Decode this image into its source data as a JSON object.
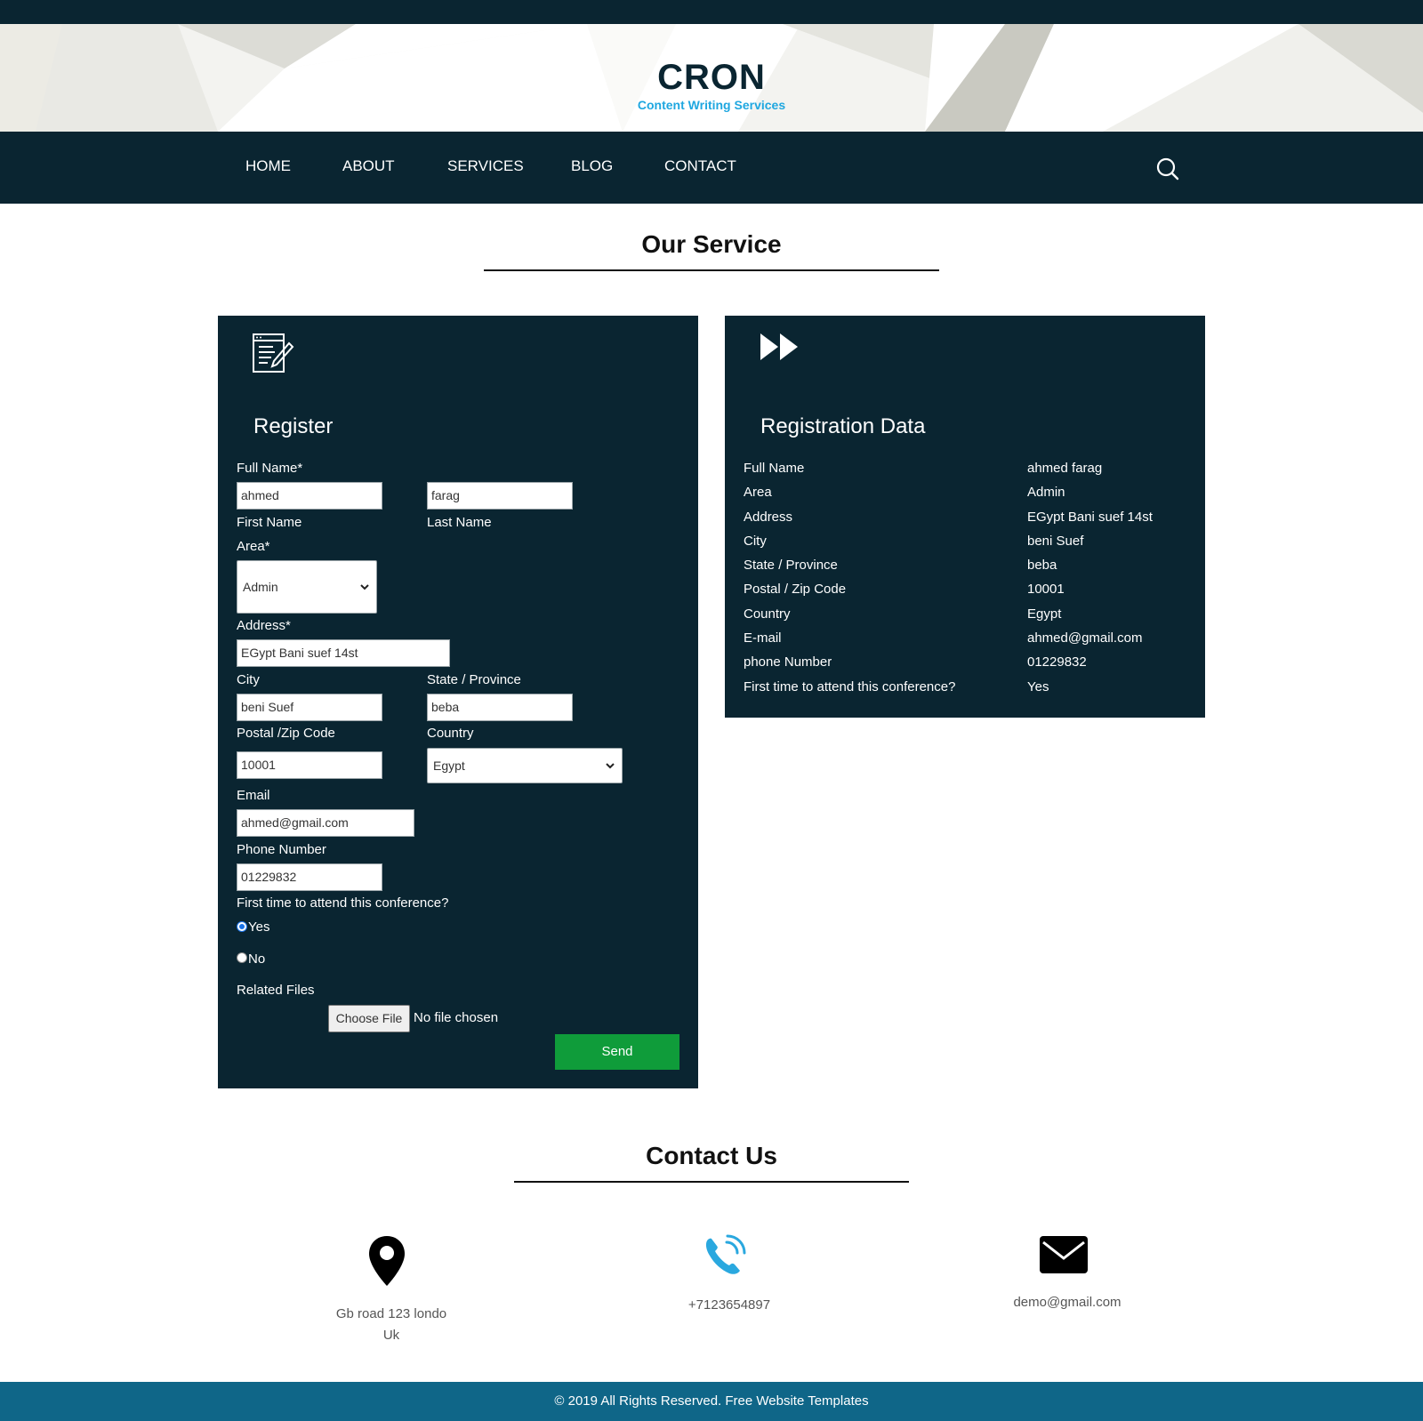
{
  "brand": {
    "name": "CRON",
    "tagline": "Content Writing Services"
  },
  "nav": {
    "items": [
      "HOME",
      "ABOUT",
      "SERVICES",
      "BLOG",
      "CONTACT"
    ],
    "search_icon": "search-icon"
  },
  "service_section": {
    "title": "Our Service"
  },
  "register": {
    "icon": "document-edit-icon",
    "title": "Register",
    "full_name_label": "Full Name*",
    "first_name_value": "ahmed",
    "last_name_value": "farag",
    "first_name_label": "First Name",
    "last_name_label": "Last Name",
    "area_label": "Area*",
    "area_value": "Admin",
    "address_label": "Address*",
    "address_value": "EGypt Bani suef 14st",
    "city_label": "City",
    "city_value": "beni Suef",
    "state_label": "State / Province",
    "state_value": "beba",
    "postal_label": "Postal /Zip Code",
    "postal_value": "10001",
    "country_label": "Country",
    "country_value": "Egypt",
    "email_label": "Email",
    "email_value": "ahmed@gmail.com",
    "phone_label": "Phone Number",
    "phone_value": "01229832",
    "first_time_label": "First time to attend this conference?",
    "yes_label": "Yes",
    "no_label": "No",
    "yes_checked": true,
    "files_label": "Related Files",
    "choose_file_label": "Choose File",
    "no_file_text": "No file chosen",
    "send_label": "Send"
  },
  "registration_data": {
    "icon": "fast-forward-icon",
    "title": "Registration Data",
    "rows": [
      {
        "label": "Full Name",
        "value": "ahmed farag"
      },
      {
        "label": "Area",
        "value": "Admin"
      },
      {
        "label": "Address",
        "value": "EGypt Bani suef 14st"
      },
      {
        "label": "City",
        "value": "beni Suef"
      },
      {
        "label": "State / Province",
        "value": "beba"
      },
      {
        "label": "Postal / Zip Code",
        "value": "10001"
      },
      {
        "label": "Country",
        "value": "Egypt"
      },
      {
        "label": "E-mail",
        "value": "ahmed@gmail.com"
      },
      {
        "label": "phone Number",
        "value": "01229832"
      },
      {
        "label": "First time to attend this conference?",
        "value": "Yes"
      }
    ]
  },
  "contact": {
    "title": "Contact Us",
    "address_line1": "Gb road 123 londo",
    "address_line2": "Uk",
    "phone": "+7123654897",
    "email": "demo@gmail.com",
    "icons": [
      "location-pin-icon",
      "phone-icon",
      "envelope-icon"
    ],
    "phone_icon_color": "#2aa8df"
  },
  "footer": {
    "text": "© 2019 All Rights Reserved. Free Website Templates"
  },
  "colors": {
    "dark": "#0a2531",
    "brand_tag": "#1fa7e0",
    "send": "#0f9c3a",
    "footer": "#0f6688"
  }
}
